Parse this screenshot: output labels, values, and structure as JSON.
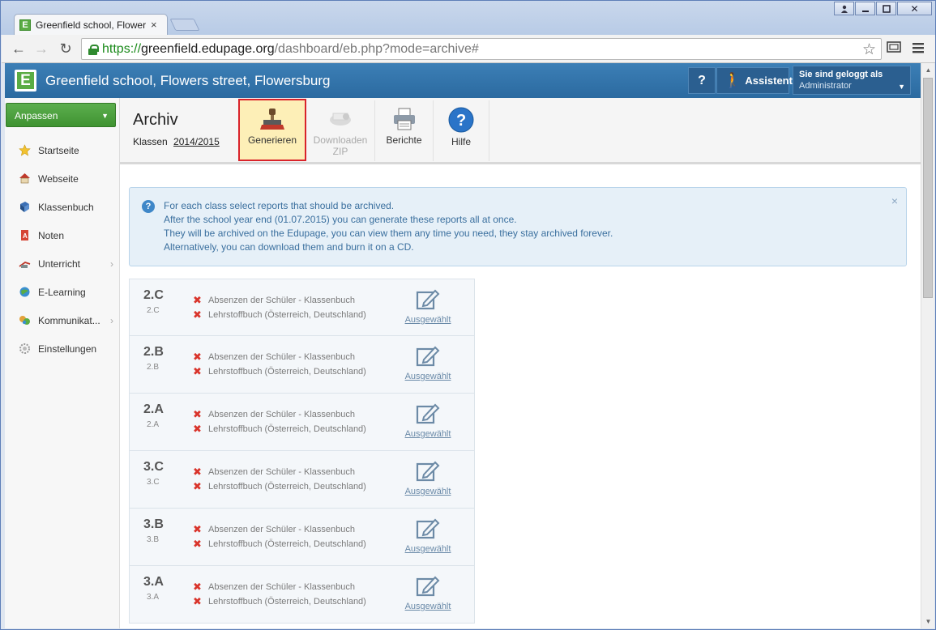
{
  "browser": {
    "tab_title": "Greenfield school, Flowers",
    "url_scheme": "https://",
    "url_host": "greenfield.edupage.org",
    "url_path": "/dashboard/eb.php?mode=archive#"
  },
  "header": {
    "school_name": "Greenfield school, Flowers street, Flowersburg",
    "help_label": "?",
    "assistant_label": "Assistent",
    "logged_in_as": "Sie sind geloggt als",
    "user": "Administrator"
  },
  "sidebar": {
    "customize_label": "Anpassen",
    "items": [
      {
        "label": "Startseite",
        "icon": "star-icon"
      },
      {
        "label": "Webseite",
        "icon": "house-icon"
      },
      {
        "label": "Klassenbuch",
        "icon": "book-icon"
      },
      {
        "label": "Noten",
        "icon": "grades-icon"
      },
      {
        "label": "Unterricht",
        "icon": "lesson-icon"
      },
      {
        "label": "E-Learning",
        "icon": "elearning-icon"
      },
      {
        "label": "Kommunikat...",
        "icon": "communication-icon"
      },
      {
        "label": "Einstellungen",
        "icon": "settings-icon"
      }
    ]
  },
  "page": {
    "title": "Archiv",
    "klassen_label": "Klassen",
    "klassen_year": "2014/2015",
    "toolbar": {
      "generate": "Generieren",
      "download_line1": "Downloaden",
      "download_line2": "ZIP",
      "reports": "Berichte",
      "help": "Hilfe"
    },
    "info": [
      "For each class select reports that should be archived.",
      "After the school year end (01.07.2015) you can generate these reports all at once.",
      "They will be archived on the Edupage, you can view them any time you need, they stay archived forever.",
      "Alternatively, you can download them and burn it on a CD."
    ],
    "report_1": "Absenzen der Schüler - Klassenbuch",
    "report_2": "Lehrstoffbuch (Österreich, Deutschland)",
    "selected_label": "Ausgewählt",
    "classes": [
      {
        "name": "2.C",
        "sub": "2.C"
      },
      {
        "name": "2.B",
        "sub": "2.B"
      },
      {
        "name": "2.A",
        "sub": "2.A"
      },
      {
        "name": "3.C",
        "sub": "3.C"
      },
      {
        "name": "3.B",
        "sub": "3.B"
      },
      {
        "name": "3.A",
        "sub": "3.A"
      }
    ]
  },
  "colors": {
    "header_blue": "#2b6aa0",
    "green": "#4aa03c",
    "highlight_red": "#d9232a",
    "cross_red": "#d9342b"
  }
}
